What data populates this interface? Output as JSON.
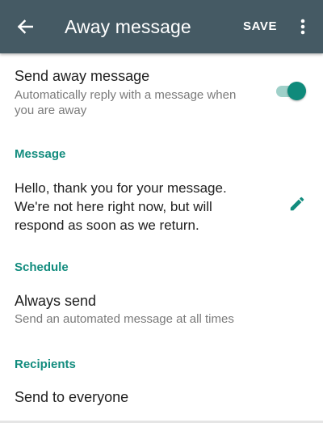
{
  "appbar": {
    "title": "Away message",
    "save_label": "SAVE",
    "color": "#455a64"
  },
  "away_toggle": {
    "title": "Send away message",
    "subtitle": "Automatically reply with a message when you are away",
    "enabled": true,
    "accent": "#128c7e"
  },
  "message_section": {
    "header": "Message",
    "text": "Hello, thank you for your message. We're not here right now, but will respond as soon as we return."
  },
  "schedule_section": {
    "header": "Schedule",
    "option_title": "Always send",
    "option_subtitle": "Send an automated message at all times"
  },
  "recipients_section": {
    "header": "Recipients",
    "option_title": "Send to everyone"
  },
  "icons": {
    "back": "arrow-back-icon",
    "more": "more-vert-icon",
    "edit": "pencil-icon"
  }
}
